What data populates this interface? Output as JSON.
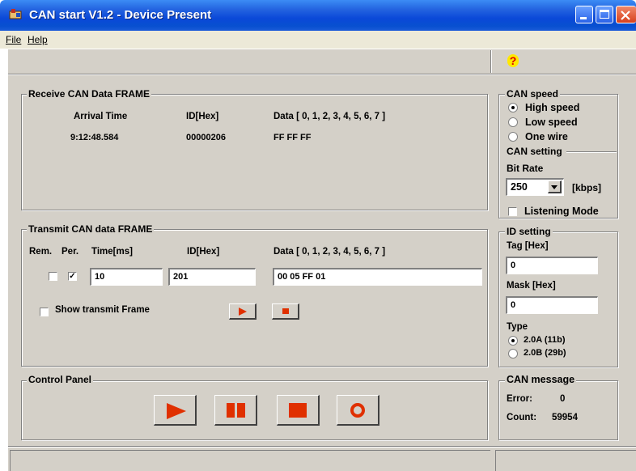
{
  "window": {
    "title": "CAN start  V1.2  -  Device Present"
  },
  "menu": {
    "file": "File",
    "help": "Help"
  },
  "toolbar": {
    "help_icon": "help-question-icon",
    "help_glyph": "?"
  },
  "receive": {
    "title": "Receive CAN Data FRAME",
    "headers": {
      "arrival": "Arrival Time",
      "id": "ID[Hex]",
      "data": "Data [ 0,  1,  2,  3,  4,  5,  6,  7 ]"
    },
    "row": {
      "arrival": "9:12:48.584",
      "id": "00000206",
      "data": "FF  FF  FF"
    }
  },
  "transmit": {
    "title": "Transmit CAN data FRAME",
    "headers": {
      "rem": "Rem.",
      "per": "Per.",
      "time": "Time[ms]",
      "id": "ID[Hex]",
      "data": "Data [ 0,  1,  2,  3,  4,  5,  6,  7 ]"
    },
    "row": {
      "rem_checked": false,
      "per_checked": true,
      "time": "10",
      "id": "201",
      "data": "00 05 FF 01"
    },
    "show_frame_label": "Show transmit Frame",
    "show_frame_checked": false
  },
  "control": {
    "title": "Control Panel"
  },
  "speed": {
    "title": "CAN speed",
    "options": [
      "High speed",
      "Low speed",
      "One wire"
    ],
    "selected": "High speed"
  },
  "setting": {
    "title": "CAN setting",
    "bitrate_label": "Bit Rate",
    "bitrate_value": "250",
    "bitrate_unit": "[kbps]",
    "listening_label": "Listening Mode",
    "listening_checked": false
  },
  "id_setting": {
    "title": "ID setting",
    "tag_label": "Tag [Hex]",
    "tag_value": "0",
    "mask_label": "Mask [Hex]",
    "mask_value": "0",
    "type_label": "Type",
    "types": [
      "2.0A (11b)",
      "2.0B (29b)"
    ],
    "type_selected": "2.0A (11b)"
  },
  "message": {
    "title": "CAN message",
    "error_label": "Error:",
    "error_value": "0",
    "count_label": "Count:",
    "count_value": "59954"
  },
  "colors": {
    "accent_red": "#e03000",
    "titlebar": "#0a48d8",
    "face": "#d4d0c8"
  }
}
